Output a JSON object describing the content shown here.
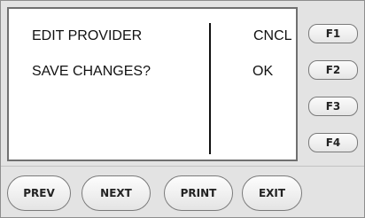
{
  "screen": {
    "title": "EDIT PROVIDER",
    "prompt": "SAVE CHANGES?",
    "options": {
      "cancel": "CNCL",
      "ok": "OK"
    }
  },
  "function_keys": {
    "f1": "F1",
    "f2": "F2",
    "f3": "F3",
    "f4": "F4"
  },
  "nav_keys": {
    "prev": "PREV",
    "next": "NEXT",
    "print": "PRINT",
    "exit": "EXIT"
  }
}
